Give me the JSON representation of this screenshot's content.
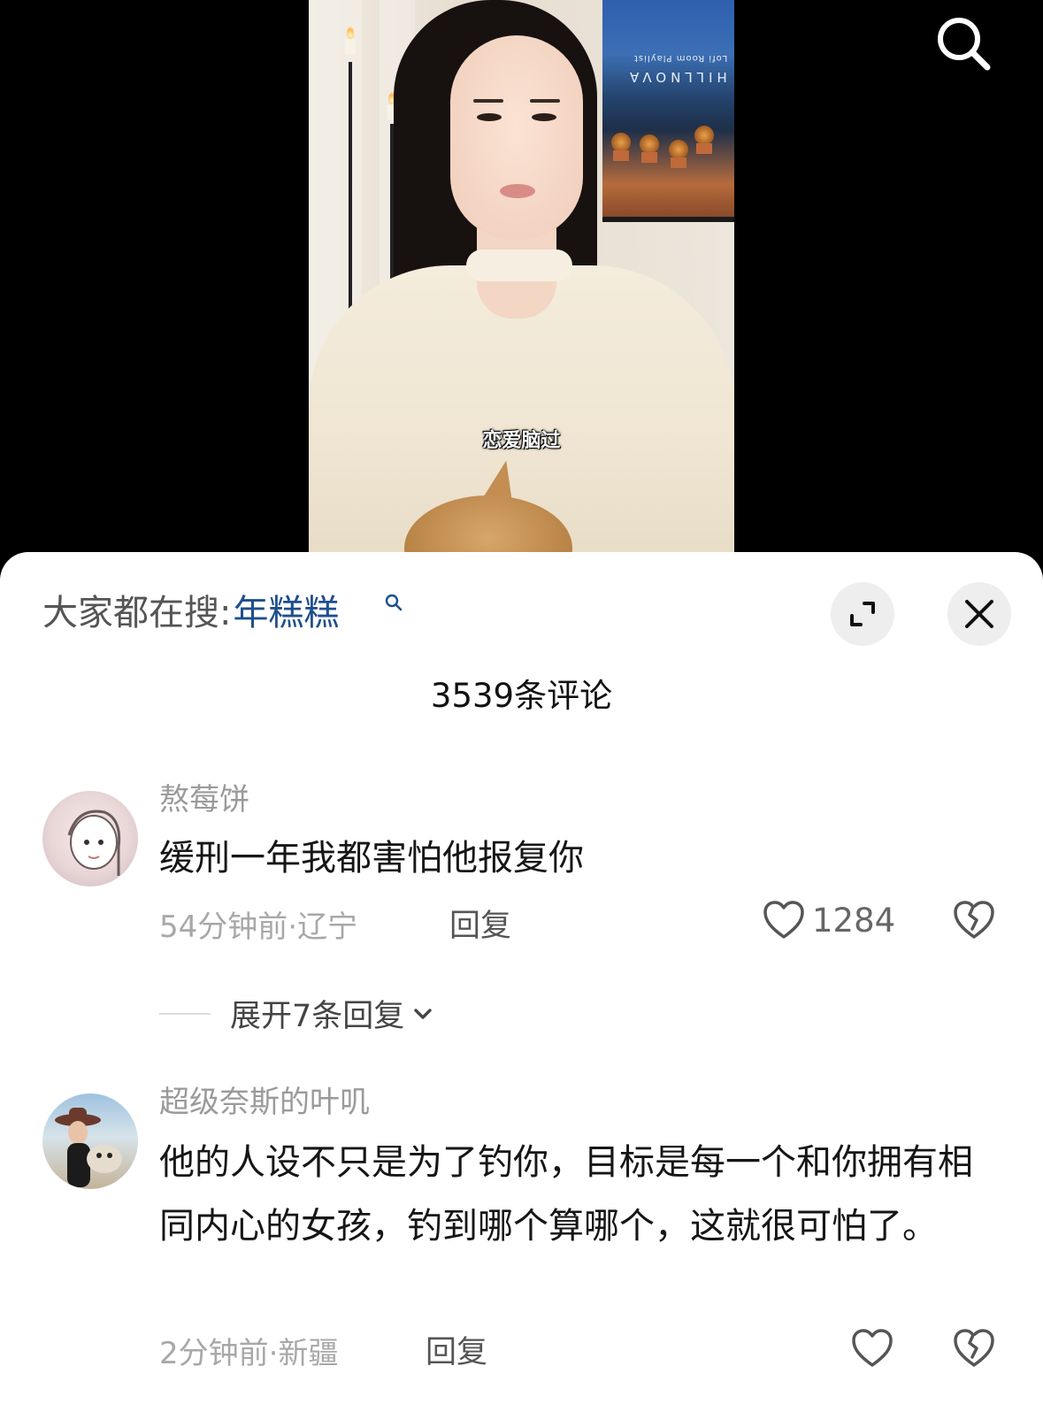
{
  "video": {
    "subtitle": "恋爱脑过",
    "tv_line1": "Lofi Room Playlist",
    "tv_line2": "HILLNOVA"
  },
  "header": {
    "search_hint_label": "大家都在搜:",
    "search_hint_keyword": "年糕糕",
    "comment_count": "3539条评论"
  },
  "comments": [
    {
      "username": "熬莓饼",
      "text": "缓刑一年我都害怕他报复你",
      "meta": "54分钟前·辽宁",
      "reply_label": "回复",
      "likes": "1284",
      "expand_replies": "展开7条回复"
    },
    {
      "username": "超级奈斯的叶叽",
      "text": "他的人设不只是为了钓你，目标是每一个和你拥有相同内心的女孩，钓到哪个算哪个，这就很可怕了。",
      "meta": "2分钟前·新疆",
      "reply_label": "回复"
    }
  ],
  "icons": {
    "search": "search-icon",
    "expand": "expand-icon",
    "close": "close-icon",
    "like": "heart-icon",
    "dislike": "broken-heart-icon",
    "chevron": "chevron-down-icon"
  },
  "colors": {
    "keyword": "#1f4e8c",
    "muted": "#9a9a9a",
    "text": "#161616"
  }
}
